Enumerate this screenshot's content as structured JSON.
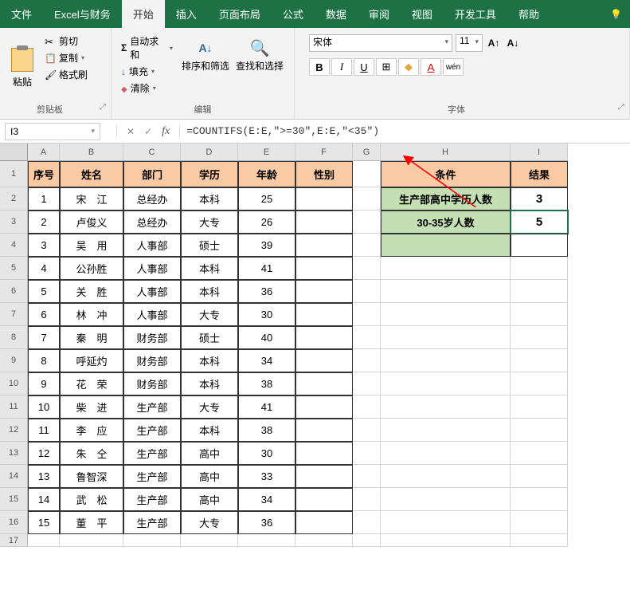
{
  "menubar": {
    "items": [
      "文件",
      "Excel与财务",
      "开始",
      "插入",
      "页面布局",
      "公式",
      "数据",
      "审阅",
      "视图",
      "开发工具",
      "帮助"
    ],
    "active": 2
  },
  "ribbon": {
    "clipboard": {
      "paste": "粘贴",
      "cut": "剪切",
      "copy": "复制",
      "format_painter": "格式刷",
      "group_label": "剪贴板"
    },
    "editing": {
      "autosum": "自动求和",
      "fill": "填充",
      "clear": "清除",
      "sort_filter": "排序和筛选",
      "find_select": "查找和选择",
      "group_label": "编辑"
    },
    "font": {
      "name": "宋体",
      "size": "11",
      "bold": "B",
      "italic": "I",
      "underline": "U",
      "wen": "wén",
      "group_label": "字体"
    }
  },
  "formula_bar": {
    "name_box": "I3",
    "fx": "fx",
    "formula": "=COUNTIFS(E:E,\">=30\",E:E,\"<35\")"
  },
  "columns": [
    "A",
    "B",
    "C",
    "D",
    "E",
    "F",
    "G",
    "H",
    "I"
  ],
  "row_labels": [
    "1",
    "2",
    "3",
    "4",
    "5",
    "6",
    "7",
    "8",
    "9",
    "10",
    "11",
    "12",
    "13",
    "14",
    "15",
    "16",
    "17"
  ],
  "headers": {
    "序号": "序号",
    "姓名": "姓名",
    "部门": "部门",
    "学历": "学历",
    "年龄": "年龄",
    "性别": "性别",
    "条件": "条件",
    "结果": "结果"
  },
  "chart_data": {
    "type": "table",
    "main": [
      {
        "序号": "1",
        "姓名": "宋　江",
        "部门": "总经办",
        "学历": "本科",
        "年龄": 25,
        "性别": ""
      },
      {
        "序号": "2",
        "姓名": "卢俊义",
        "部门": "总经办",
        "学历": "大专",
        "年龄": 26,
        "性别": ""
      },
      {
        "序号": "3",
        "姓名": "吴　用",
        "部门": "人事部",
        "学历": "硕士",
        "年龄": 39,
        "性别": ""
      },
      {
        "序号": "4",
        "姓名": "公孙胜",
        "部门": "人事部",
        "学历": "本科",
        "年龄": 41,
        "性别": ""
      },
      {
        "序号": "5",
        "姓名": "关　胜",
        "部门": "人事部",
        "学历": "本科",
        "年龄": 36,
        "性别": ""
      },
      {
        "序号": "6",
        "姓名": "林　冲",
        "部门": "人事部",
        "学历": "大专",
        "年龄": 30,
        "性别": ""
      },
      {
        "序号": "7",
        "姓名": "秦　明",
        "部门": "财务部",
        "学历": "硕士",
        "年龄": 40,
        "性别": ""
      },
      {
        "序号": "8",
        "姓名": "呼延灼",
        "部门": "财务部",
        "学历": "本科",
        "年龄": 34,
        "性别": ""
      },
      {
        "序号": "9",
        "姓名": "花　荣",
        "部门": "财务部",
        "学历": "本科",
        "年龄": 38,
        "性别": ""
      },
      {
        "序号": "10",
        "姓名": "柴　进",
        "部门": "生产部",
        "学历": "大专",
        "年龄": 41,
        "性别": ""
      },
      {
        "序号": "11",
        "姓名": "李　应",
        "部门": "生产部",
        "学历": "本科",
        "年龄": 38,
        "性别": ""
      },
      {
        "序号": "12",
        "姓名": "朱　仝",
        "部门": "生产部",
        "学历": "高中",
        "年龄": 30,
        "性别": ""
      },
      {
        "序号": "13",
        "姓名": "鲁智深",
        "部门": "生产部",
        "学历": "高中",
        "年龄": 33,
        "性别": ""
      },
      {
        "序号": "14",
        "姓名": "武　松",
        "部门": "生产部",
        "学历": "高中",
        "年龄": 34,
        "性别": ""
      },
      {
        "序号": "15",
        "姓名": "董　平",
        "部门": "生产部",
        "学历": "大专",
        "年龄": 36,
        "性别": ""
      }
    ],
    "results": [
      {
        "条件": "生产部高中学历人数",
        "结果": 3
      },
      {
        "条件": "30-35岁人数",
        "结果": 5
      },
      {
        "条件": "",
        "结果": ""
      }
    ]
  }
}
